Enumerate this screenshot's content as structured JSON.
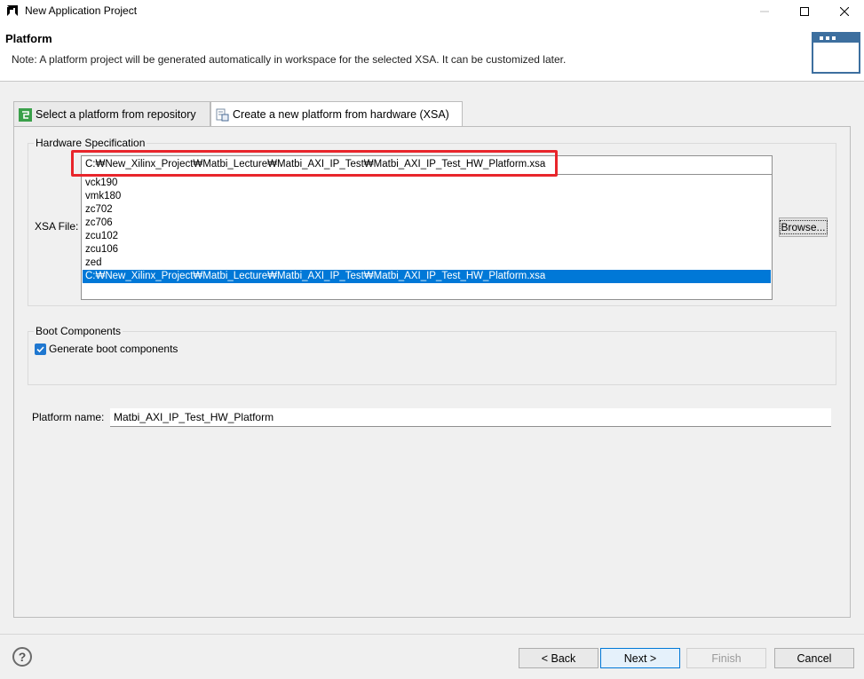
{
  "window": {
    "title": "New Application Project"
  },
  "header": {
    "title": "Platform",
    "note": "Note: A platform project will be generated automatically in workspace for the selected XSA. It can be customized later."
  },
  "tabs": [
    {
      "label": "Select a platform from repository",
      "selected": false
    },
    {
      "label": "Create a new platform from hardware (XSA)",
      "selected": true
    }
  ],
  "hardware_spec": {
    "group_label": "Hardware Specification",
    "xsa_label": "XSA File:",
    "xsa_value": "C:₩New_Xilinx_Project₩Matbi_Lecture₩Matbi_AXI_IP_Test₩Matbi_AXI_IP_Test_HW_Platform.xsa",
    "options": [
      "vck190",
      "vmk180",
      "zc702",
      "zc706",
      "zcu102",
      "zcu106",
      "zed",
      "C:₩New_Xilinx_Project₩Matbi_Lecture₩Matbi_AXI_IP_Test₩Matbi_AXI_IP_Test_HW_Platform.xsa"
    ],
    "browse_label": "Browse..."
  },
  "boot": {
    "group_label": "Boot Components",
    "checkbox_label": "Generate boot components",
    "checked": true
  },
  "platform_name": {
    "label": "Platform name:",
    "value": "Matbi_AXI_IP_Test_HW_Platform"
  },
  "buttons": {
    "help": "?",
    "back": "< Back",
    "next": "Next >",
    "finish": "Finish",
    "cancel": "Cancel"
  },
  "colors": {
    "selection": "#0078d7",
    "highlight_box": "#e8252b",
    "accent_icon": "#3d6f9f"
  }
}
